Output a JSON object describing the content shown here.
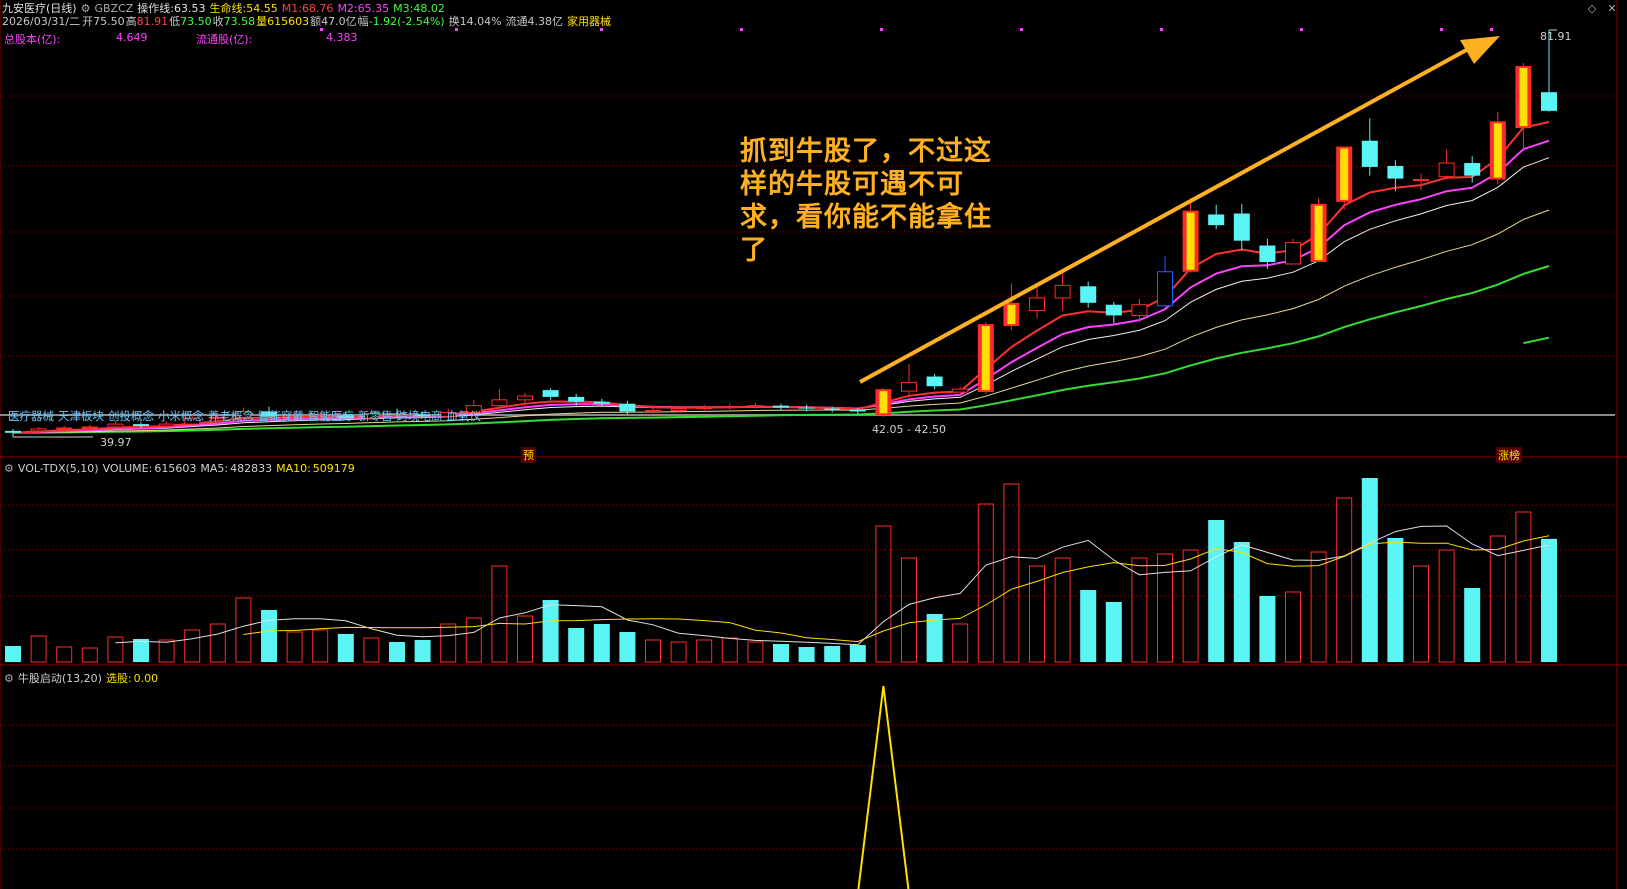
{
  "colors": {
    "up": "#ff2a2a",
    "down": "#5cf5f5",
    "ma1": "#ff3030",
    "ma2": "#ff40ff",
    "ma3": "#f0f0f0",
    "ma4": "#e8d890",
    "ma5": "#33dd33",
    "arrow": "#ffb020",
    "grid": "#8b0000",
    "yellow": "#ffe000"
  },
  "header": {
    "stock_name": "九安医疗(日线)",
    "code": "GBZCZ",
    "op_label": "操作线:",
    "op_value": "63.53",
    "life_label": "生命线:",
    "life_value": "54.55",
    "m1_label": "M1:",
    "m1_value": "68.76",
    "m2_label": "M2:",
    "m2_value": "65.35",
    "m3_label": "M3:",
    "m3_value": "48.02",
    "date": "2026/03/31/二",
    "open_label": "开",
    "open_value": "75.50",
    "high_label": "高",
    "high_value": "81.91",
    "low_label": "低",
    "low_value": "73.50",
    "close_label": "收",
    "close_value": "73.58",
    "vol_label": "量",
    "vol_value": "615603",
    "amt_label": "额",
    "amt_value": "47.0亿",
    "chg_label": "幅",
    "chg_value": "-1.92(-2.54%)",
    "turn_label": "换",
    "turn_value": "14.04%",
    "float_label": "流通",
    "float_value": "4.38亿",
    "industry": "家用器械",
    "total_share_label": "总股本(亿):",
    "total_share_value": "4.649",
    "float_share_label": "流通股(亿):",
    "float_share_value": "4.383"
  },
  "price_chart": {
    "high_label": "81.91",
    "low_label": "39.97",
    "range_label": "42.05 - 42.50",
    "marker_yu": "预",
    "marker_zhang": "涨榜",
    "annotation": "抓到牛股了，不过这样的牛股可遇不可求，看你能不能拿住了"
  },
  "tags": [
    "医疗器械",
    "天津板块",
    "创投概念",
    "小米概念",
    "养老概念",
    "智能穿戴",
    "智能医疗",
    "新零售",
    "跨境电商",
    "血氧仪"
  ],
  "volume_panel": {
    "title": "VOL-TDX(5,10)",
    "volume_label": "VOLUME:",
    "volume_value": "615603",
    "ma5_label": "MA5:",
    "ma5_value": "482833",
    "ma10_label": "MA10:",
    "ma10_value": "509179"
  },
  "indicator_panel": {
    "title": "牛股启动(13,20)",
    "select_label": "选股:",
    "select_value": "0.00"
  },
  "chart_data": {
    "type": "candlestick",
    "bars": [
      {
        "o": 40.6,
        "c": 40.4,
        "h": 40.8,
        "l": 39.97,
        "v": 80000
      },
      {
        "o": 40.6,
        "c": 40.8,
        "h": 41.0,
        "l": 40.3,
        "v": 130000
      },
      {
        "o": 40.8,
        "c": 40.9,
        "h": 41.1,
        "l": 40.5,
        "v": 75000
      },
      {
        "o": 40.9,
        "c": 41.0,
        "h": 41.2,
        "l": 40.7,
        "v": 70000
      },
      {
        "o": 41.0,
        "c": 41.3,
        "h": 41.6,
        "l": 40.8,
        "v": 125000
      },
      {
        "o": 41.3,
        "c": 41.1,
        "h": 41.5,
        "l": 40.9,
        "v": 115000
      },
      {
        "o": 41.1,
        "c": 41.3,
        "h": 41.6,
        "l": 40.9,
        "v": 110000
      },
      {
        "o": 41.3,
        "c": 41.9,
        "h": 42.2,
        "l": 41.1,
        "v": 160000
      },
      {
        "o": 41.9,
        "c": 42.0,
        "h": 42.4,
        "l": 41.6,
        "v": 190000
      },
      {
        "o": 42.0,
        "c": 42.6,
        "h": 43.0,
        "l": 41.8,
        "v": 320000
      },
      {
        "o": 42.6,
        "c": 42.1,
        "h": 43.1,
        "l": 41.9,
        "v": 260000
      },
      {
        "o": 42.1,
        "c": 42.1,
        "h": 42.6,
        "l": 41.8,
        "v": 150000
      },
      {
        "o": 42.1,
        "c": 42.2,
        "h": 42.5,
        "l": 41.8,
        "v": 160000
      },
      {
        "o": 42.2,
        "c": 41.9,
        "h": 42.6,
        "l": 41.7,
        "v": 140000
      },
      {
        "o": 41.9,
        "c": 42.4,
        "h": 42.8,
        "l": 41.7,
        "v": 120000
      },
      {
        "o": 42.4,
        "c": 42.3,
        "h": 42.9,
        "l": 42.0,
        "v": 100000
      },
      {
        "o": 42.3,
        "c": 42.1,
        "h": 42.6,
        "l": 41.9,
        "v": 110000
      },
      {
        "o": 42.1,
        "c": 42.5,
        "h": 42.9,
        "l": 41.9,
        "v": 190000
      },
      {
        "o": 42.5,
        "c": 43.2,
        "h": 43.8,
        "l": 42.2,
        "v": 220000
      },
      {
        "o": 43.2,
        "c": 43.8,
        "h": 44.9,
        "l": 43.0,
        "v": 480000
      },
      {
        "o": 43.8,
        "c": 44.2,
        "h": 44.5,
        "l": 43.5,
        "v": 230000
      },
      {
        "o": 44.8,
        "c": 44.1,
        "h": 45.0,
        "l": 43.8,
        "v": 310000
      },
      {
        "o": 44.1,
        "c": 43.6,
        "h": 44.4,
        "l": 43.2,
        "v": 170000
      },
      {
        "o": 43.6,
        "c": 43.4,
        "h": 43.9,
        "l": 43.1,
        "v": 190000
      },
      {
        "o": 43.4,
        "c": 42.6,
        "h": 43.7,
        "l": 42.3,
        "v": 150000
      },
      {
        "o": 42.6,
        "c": 42.7,
        "h": 43.0,
        "l": 42.4,
        "v": 110000
      },
      {
        "o": 42.7,
        "c": 42.9,
        "h": 43.2,
        "l": 42.5,
        "v": 100000
      },
      {
        "o": 42.9,
        "c": 43.0,
        "h": 43.3,
        "l": 42.7,
        "v": 110000
      },
      {
        "o": 43.0,
        "c": 43.1,
        "h": 43.4,
        "l": 42.8,
        "v": 120000
      },
      {
        "o": 43.1,
        "c": 43.2,
        "h": 43.5,
        "l": 42.9,
        "v": 100000
      },
      {
        "o": 43.2,
        "c": 43.0,
        "h": 43.4,
        "l": 42.7,
        "v": 90000
      },
      {
        "o": 43.0,
        "c": 42.9,
        "h": 43.3,
        "l": 42.6,
        "v": 75000
      },
      {
        "o": 42.9,
        "c": 42.8,
        "h": 43.1,
        "l": 42.5,
        "v": 80000
      },
      {
        "o": 42.8,
        "c": 42.6,
        "h": 43.0,
        "l": 42.3,
        "v": 85000
      },
      {
        "o": 42.2,
        "c": 44.9,
        "h": 45.0,
        "l": 42.05,
        "v": 680000
      },
      {
        "o": 44.7,
        "c": 45.6,
        "h": 47.5,
        "l": 44.3,
        "v": 520000
      },
      {
        "o": 46.2,
        "c": 45.2,
        "h": 46.5,
        "l": 44.9,
        "v": 240000
      },
      {
        "o": 44.6,
        "c": 44.9,
        "h": 45.2,
        "l": 44.3,
        "v": 190000
      },
      {
        "o": 44.6,
        "c": 51.6,
        "h": 51.8,
        "l": 44.4,
        "v": 790000
      },
      {
        "o": 51.4,
        "c": 53.8,
        "h": 55.8,
        "l": 51.0,
        "v": 890000
      },
      {
        "o": 53.0,
        "c": 54.3,
        "h": 55.6,
        "l": 52.2,
        "v": 480000
      },
      {
        "o": 54.3,
        "c": 55.6,
        "h": 56.8,
        "l": 53.0,
        "v": 520000
      },
      {
        "o": 55.5,
        "c": 53.8,
        "h": 56.0,
        "l": 53.3,
        "v": 360000
      },
      {
        "o": 53.6,
        "c": 52.5,
        "h": 53.9,
        "l": 51.7,
        "v": 300000
      },
      {
        "o": 52.5,
        "c": 53.6,
        "h": 54.2,
        "l": 51.8,
        "v": 520000
      },
      {
        "o": 53.5,
        "c": 57.0,
        "h": 58.6,
        "l": 53.3,
        "v": 540000
      },
      {
        "o": 57.0,
        "c": 63.3,
        "h": 64.6,
        "l": 56.9,
        "v": 560000
      },
      {
        "o": 62.9,
        "c": 61.8,
        "h": 63.9,
        "l": 61.4,
        "v": 710000
      },
      {
        "o": 63.0,
        "c": 60.2,
        "h": 64.0,
        "l": 59.2,
        "v": 600000
      },
      {
        "o": 59.7,
        "c": 58.0,
        "h": 60.4,
        "l": 57.3,
        "v": 330000
      },
      {
        "o": 57.8,
        "c": 60.0,
        "h": 60.4,
        "l": 57.8,
        "v": 350000
      },
      {
        "o": 58.0,
        "c": 64.0,
        "h": 64.6,
        "l": 58.0,
        "v": 550000
      },
      {
        "o": 64.2,
        "c": 69.9,
        "h": 69.9,
        "l": 63.4,
        "v": 820000
      },
      {
        "o": 70.5,
        "c": 67.8,
        "h": 72.8,
        "l": 66.9,
        "v": 920000
      },
      {
        "o": 67.9,
        "c": 66.6,
        "h": 68.5,
        "l": 65.3,
        "v": 620000
      },
      {
        "o": 66.5,
        "c": 66.5,
        "h": 67.1,
        "l": 65.4,
        "v": 480000
      },
      {
        "o": 66.8,
        "c": 68.2,
        "h": 69.6,
        "l": 66.5,
        "v": 560000
      },
      {
        "o": 68.2,
        "c": 66.9,
        "h": 68.9,
        "l": 66.2,
        "v": 370000
      },
      {
        "o": 66.5,
        "c": 72.5,
        "h": 73.5,
        "l": 66.0,
        "v": 630000
      },
      {
        "o": 71.8,
        "c": 78.2,
        "h": 78.5,
        "l": 69.4,
        "v": 750000
      },
      {
        "o": 75.5,
        "c": 73.58,
        "h": 81.91,
        "l": 73.5,
        "v": 615603
      }
    ],
    "indicator_spike_index": 34,
    "special_bars": [
      34,
      38,
      39,
      46,
      51,
      52,
      58,
      59
    ],
    "blue_bar": 45
  }
}
